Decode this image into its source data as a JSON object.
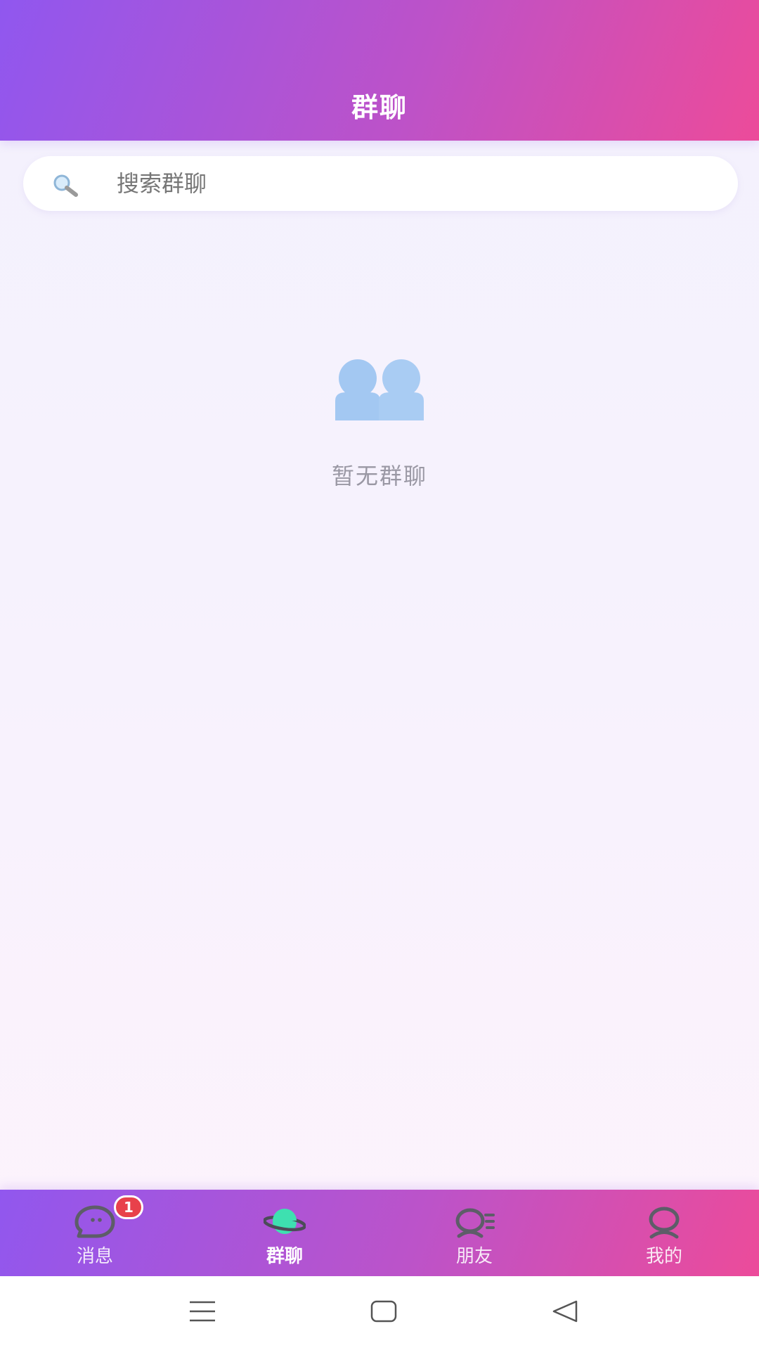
{
  "header": {
    "title": "群聊"
  },
  "search": {
    "icon": "search-icon",
    "placeholder": "搜索群聊",
    "value": ""
  },
  "empty_state": {
    "icon": "group-users-icon",
    "text": "暂无群聊"
  },
  "tabbar": {
    "tabs": [
      {
        "label": "消息",
        "icon": "chat-bubble-icon",
        "badge": "1",
        "active": false
      },
      {
        "label": "群聊",
        "icon": "planet-icon",
        "active": true
      },
      {
        "label": "朋友",
        "icon": "friends-icon",
        "active": false
      },
      {
        "label": "我的",
        "icon": "profile-icon",
        "active": false
      }
    ]
  },
  "system_nav": {
    "buttons": [
      "menu-icon",
      "home-icon",
      "back-icon"
    ]
  },
  "colors": {
    "header_gradient_start": "#9057ef",
    "header_gradient_end": "#ec4b9a",
    "badge": "#e8414b",
    "active_tab_icon": "#3ee0b0",
    "empty_icon": "#a3c8f2"
  }
}
